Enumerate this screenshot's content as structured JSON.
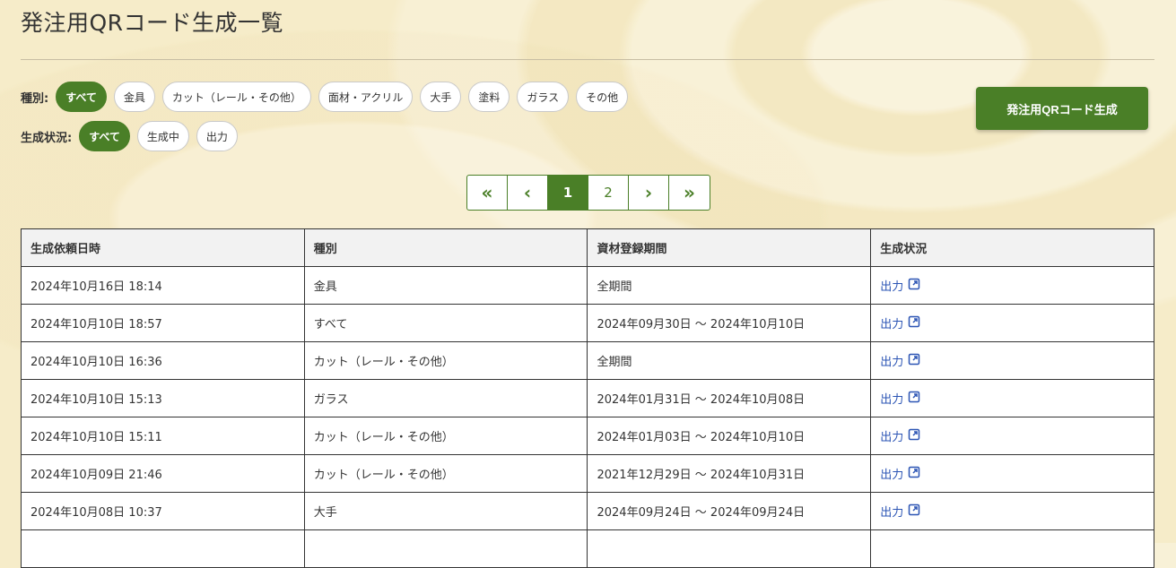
{
  "page_title": "発注用QRコード生成一覧",
  "filters": {
    "kind_label": "種別:",
    "kind_options": [
      "すべて",
      "金具",
      "カット（レール・その他）",
      "面材・アクリル",
      "大手",
      "塗料",
      "ガラス",
      "その他"
    ],
    "kind_selected": "すべて",
    "status_label": "生成状況:",
    "status_options": [
      "すべて",
      "生成中",
      "出力"
    ],
    "status_selected": "すべて"
  },
  "generate_button": "発注用QRコード生成",
  "pagination": {
    "first": "«",
    "prev": "‹",
    "pages": [
      "1",
      "2"
    ],
    "current": "1",
    "next": "›",
    "last": "»"
  },
  "table": {
    "headers": [
      "生成依頼日時",
      "種別",
      "資材登録期間",
      "生成状況"
    ],
    "rows": [
      [
        "2024年10月16日 18:14",
        "金具",
        "全期間",
        "出力"
      ],
      [
        "2024年10月10日 18:57",
        "すべて",
        "2024年09月30日 〜 2024年10月10日",
        "出力"
      ],
      [
        "2024年10月10日 16:36",
        "カット（レール・その他）",
        "全期間",
        "出力"
      ],
      [
        "2024年10月10日 15:13",
        "ガラス",
        "2024年01月31日 〜 2024年10月08日",
        "出力"
      ],
      [
        "2024年10月10日 15:11",
        "カット（レール・その他）",
        "2024年01月03日 〜 2024年10月10日",
        "出力"
      ],
      [
        "2024年10月09日 21:46",
        "カット（レール・その他）",
        "2021年12月29日 〜 2024年10月31日",
        "出力"
      ],
      [
        "2024年10月08日 10:37",
        "大手",
        "2024年09月24日 〜 2024年09月24日",
        "出力"
      ],
      [
        "",
        "",
        "",
        ""
      ]
    ]
  },
  "icons": {
    "output_link": "external-link-icon"
  },
  "colors": {
    "accent": "#4a7f27",
    "link": "#2b54b4"
  }
}
